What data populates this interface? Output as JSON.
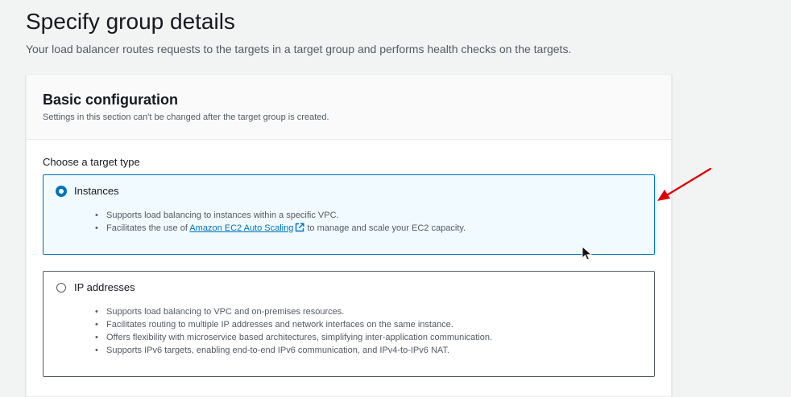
{
  "page": {
    "title": "Specify group details",
    "description": "Your load balancer routes requests to the targets in a target group and performs health checks on the targets."
  },
  "basic_configuration": {
    "title": "Basic configuration",
    "subtitle": "Settings in this section can't be changed after the target group is created.",
    "target_type_label": "Choose a target type",
    "options": [
      {
        "label": "Instances",
        "selected": true,
        "bullets": [
          "Supports load balancing to instances within a specific VPC.",
          "Facilitates the use of"
        ],
        "link_text": "Amazon EC2 Auto Scaling",
        "link_suffix": "to manage and scale your EC2 capacity."
      },
      {
        "label": "IP addresses",
        "selected": false,
        "bullets": [
          "Supports load balancing to VPC and on-premises resources.",
          "Facilitates routing to multiple IP addresses and network interfaces on the same instance.",
          "Offers flexibility with microservice based architectures, simplifying inter-application communication.",
          "Supports IPv6 targets, enabling end-to-end IPv6 communication, and IPv4-to-IPv6 NAT."
        ]
      }
    ]
  },
  "icons": {
    "external_link": "external-link-icon",
    "annotation_arrow": "red-arrow-icon",
    "cursor": "mouse-cursor-icon"
  },
  "colors": {
    "accent": "#0073bb",
    "selected_bg": "#f1faff",
    "annotation": "#e00000"
  }
}
